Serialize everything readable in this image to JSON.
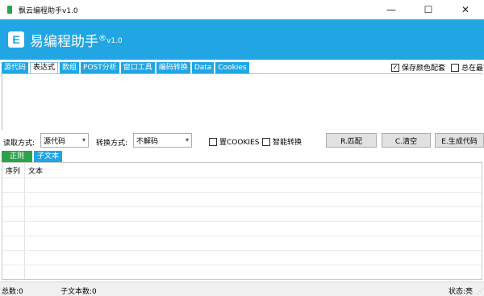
{
  "window": {
    "title": "飘云编程助手v1.0",
    "controls": {
      "minimize": "—",
      "maximize": "☐",
      "close": "✕"
    }
  },
  "banner": {
    "logo_letter": "E",
    "title": "易编程助手",
    "registered": "®",
    "version": "v1.0",
    "color": "#21a6e3"
  },
  "tabs": [
    {
      "label": "源代码",
      "active": false
    },
    {
      "label": "表达式",
      "active": true
    },
    {
      "label": "数组",
      "active": false
    },
    {
      "label": "POST分析",
      "active": false
    },
    {
      "label": "窗口工具",
      "active": false
    },
    {
      "label": "编码转换",
      "active": false
    },
    {
      "label": "Data",
      "active": false
    },
    {
      "label": "Cookies",
      "active": false
    }
  ],
  "top_options": {
    "save_colors": {
      "label": "保存颜色配套",
      "checked": true
    },
    "always_on_top": {
      "label": "总在最前",
      "checked": false
    }
  },
  "controls": {
    "read_mode_label": "读取方式:",
    "read_mode_value": "源代码",
    "convert_mode_label": "转换方式:",
    "convert_mode_value": "不解码",
    "cookies_label": "置COOKIES",
    "smart_convert_label": "智能转换",
    "match_button": "R.匹配",
    "clear_button": "C.清空",
    "generate_button": "E.生成代码"
  },
  "subtabs": [
    {
      "label": "正则"
    },
    {
      "label": "子文本"
    }
  ],
  "grid": {
    "columns": [
      "序列",
      "文本"
    ]
  },
  "status": {
    "total": "总数:0",
    "subtext_count": "子文本数:0",
    "state": "状态:亮"
  },
  "icons": {
    "app": "app-icon",
    "dropdown": "chevron-down-icon",
    "check": "check-icon"
  }
}
